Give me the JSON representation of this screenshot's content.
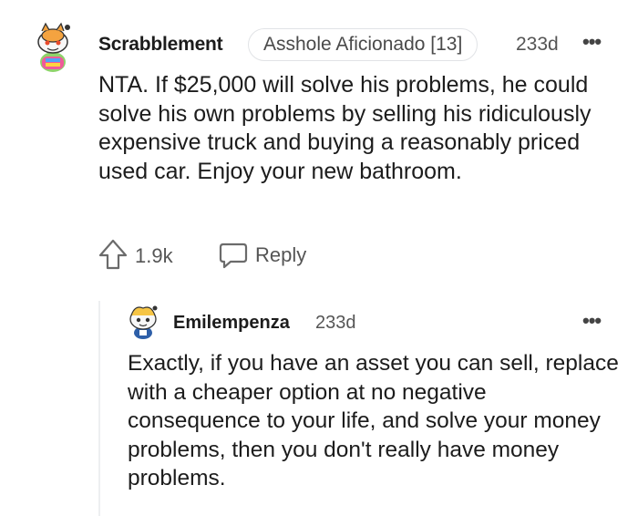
{
  "comment": {
    "username": "Scrabblement",
    "flair": "Asshole Aficionado [13]",
    "time": "233d",
    "more": "•••",
    "body": "NTA. If $25,000 will solve his problems, he could solve his own problems by selling his ridiculously expensive truck and buying a reasonably priced used car. Enjoy your new bathroom.",
    "score": "1.9k",
    "reply_label": "Reply"
  },
  "reply": {
    "username": "Emilempenza",
    "time": "233d",
    "more": "•••",
    "body": "Exactly, if you have an asset you can sell, replace with a cheaper option at no negative consequence to your life, and solve your money problems, then you don't really have money problems."
  },
  "colors": {
    "text": "#1c1c1c",
    "meta": "#555555",
    "flair_border": "#e1e3e6",
    "thread_line": "#edeff1"
  }
}
